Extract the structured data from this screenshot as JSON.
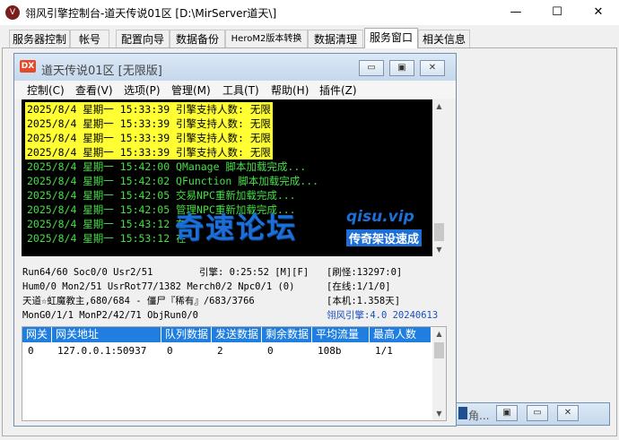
{
  "window": {
    "title": "翎风引擎控制台-道天传说01区 [D:\\MirServer道天\\]",
    "min": "—",
    "max": "☐",
    "close": "✕"
  },
  "tabs": [
    {
      "label": "服务器控制"
    },
    {
      "label": "帐号"
    },
    {
      "label": "配置向导"
    },
    {
      "label": "数据备份"
    },
    {
      "label": "HeroM2版本转换"
    },
    {
      "label": "数据清理"
    },
    {
      "label": "服务窗口",
      "active": true
    },
    {
      "label": "相关信息"
    }
  ],
  "inner": {
    "icon": "DX",
    "title": "道天传说01区 [无限版]",
    "buttons": {
      "min": "▭",
      "max": "▣",
      "close": "✕"
    },
    "menu": [
      "控制(C)",
      "查看(V)",
      "选项(P)",
      "管理(M)",
      "工具(T)",
      "帮助(H)",
      "插件(Z)"
    ]
  },
  "log": [
    {
      "text": "2025/8/4 星期一 15:33:39 引擎支持人数: 无限",
      "style": "hl"
    },
    {
      "text": "2025/8/4 星期一 15:33:39 引擎支持人数: 无限",
      "style": "hl"
    },
    {
      "text": "2025/8/4 星期一 15:33:39 引擎支持人数: 无限",
      "style": "hl"
    },
    {
      "text": "2025/8/4 星期一 15:33:39 引擎支持人数: 无限",
      "style": "hl"
    },
    {
      "text": "2025/8/4 星期一 15:42:00 QManage 脚本加载完成...",
      "style": "gr"
    },
    {
      "text": "2025/8/4 星期一 15:42:02 QFunction 脚本加载完成...",
      "style": "gr"
    },
    {
      "text": "2025/8/4 星期一 15:42:05 交易NPC重新加载完成...",
      "style": "gr"
    },
    {
      "text": "2025/8/4 星期一 15:42:05 管理NPC重新加载完成...",
      "style": "gr"
    },
    {
      "text": "2025/8/4 星期一 15:43:12 在",
      "style": "gr"
    },
    {
      "text": "2025/8/4 星期一 15:53:12 在",
      "style": "gr"
    }
  ],
  "watermark": {
    "main": "奇速论坛",
    "url": "qisu.vip",
    "sub": "传奇架设速成"
  },
  "status": {
    "line1_left": "Run64/60 Soc0/0 Usr2/51",
    "line1_mid": "引擎: 0:25:52 [M][F]",
    "line1_right": "[刷怪:13297:0]",
    "line2_left": "Hum0/0 Mon2/51 UsrRot77/1382 Merch0/2 Npc0/1 (0)",
    "line2_right": "[在线:1/1/0]",
    "line3_left": "天道☆虹魔教主,680/684 - 僵尸『稀有』/683/3766",
    "line3_right": "[本机:1.358天]",
    "line4_left": "MonG0/1/1 MonP2/42/71 ObjRun0/0",
    "line4_right": "翎风引擎:4.0 20240613"
  },
  "grid": {
    "headers": [
      "网关",
      "网关地址",
      "队列数据",
      "发送数据",
      "剩余数据",
      "平均流量",
      "最高人数"
    ],
    "rows": [
      [
        "0",
        "127.0.0.1:50937",
        "0",
        "2",
        "0",
        "108b",
        "1/1"
      ]
    ]
  },
  "minimized": {
    "title": "角..."
  }
}
